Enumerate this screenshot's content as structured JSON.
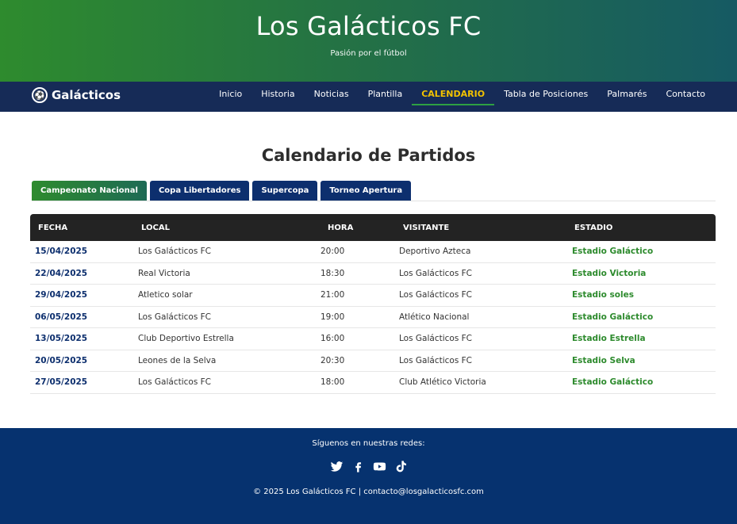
{
  "hero": {
    "title": "Los Galácticos FC",
    "subtitle": "Pasión por el fútbol"
  },
  "nav": {
    "brand": "Galácticos",
    "items": [
      "Inicio",
      "Historia",
      "Noticias",
      "Plantilla",
      "CALENDARIO",
      "Tabla de Posiciones",
      "Palmarés",
      "Contacto"
    ],
    "active_index": 4
  },
  "page": {
    "title": "Calendario de Partidos"
  },
  "tabs": [
    "Campeonato Nacional",
    "Copa Libertadores",
    "Supercopa",
    "Torneo Apertura"
  ],
  "table": {
    "headers": [
      "FECHA",
      "LOCAL",
      "HORA",
      "VISITANTE",
      "ESTADIO"
    ],
    "rows": [
      [
        "15/04/2025",
        "Los Galácticos FC",
        "20:00",
        "Deportivo Azteca",
        "Estadio Galáctico"
      ],
      [
        "22/04/2025",
        "Real Victoria",
        "18:30",
        "Los Galácticos FC",
        "Estadio Victoria"
      ],
      [
        "29/04/2025",
        "Atletico solar",
        "21:00",
        "Los Galácticos FC",
        "Estadio soles"
      ],
      [
        "06/05/2025",
        "Los Galácticos FC",
        "19:00",
        "Atlético Nacional",
        "Estadio Galáctico"
      ],
      [
        "13/05/2025",
        "Club Deportivo Estrella",
        "16:00",
        "Los Galácticos FC",
        "Estadio Estrella"
      ],
      [
        "20/05/2025",
        "Leones de la Selva",
        "20:30",
        "Los Galácticos FC",
        "Estadio Selva"
      ],
      [
        "27/05/2025",
        "Los Galácticos FC",
        "18:00",
        "Club Atlético Victoria",
        "Estadio Galáctico"
      ]
    ]
  },
  "footer": {
    "follow": "Síguenos en nuestras redes:",
    "socials": [
      "twitter-icon",
      "facebook-icon",
      "youtube-icon",
      "tiktok-icon"
    ],
    "copyright": "© 2025 Los Galácticos FC | contacto@losgalacticosfc.com"
  },
  "colors": {
    "nav_bg": "#162b57",
    "active_nav": "#f2c200",
    "accent_green": "#2e8b2e",
    "footer_bg": "#06326f"
  }
}
